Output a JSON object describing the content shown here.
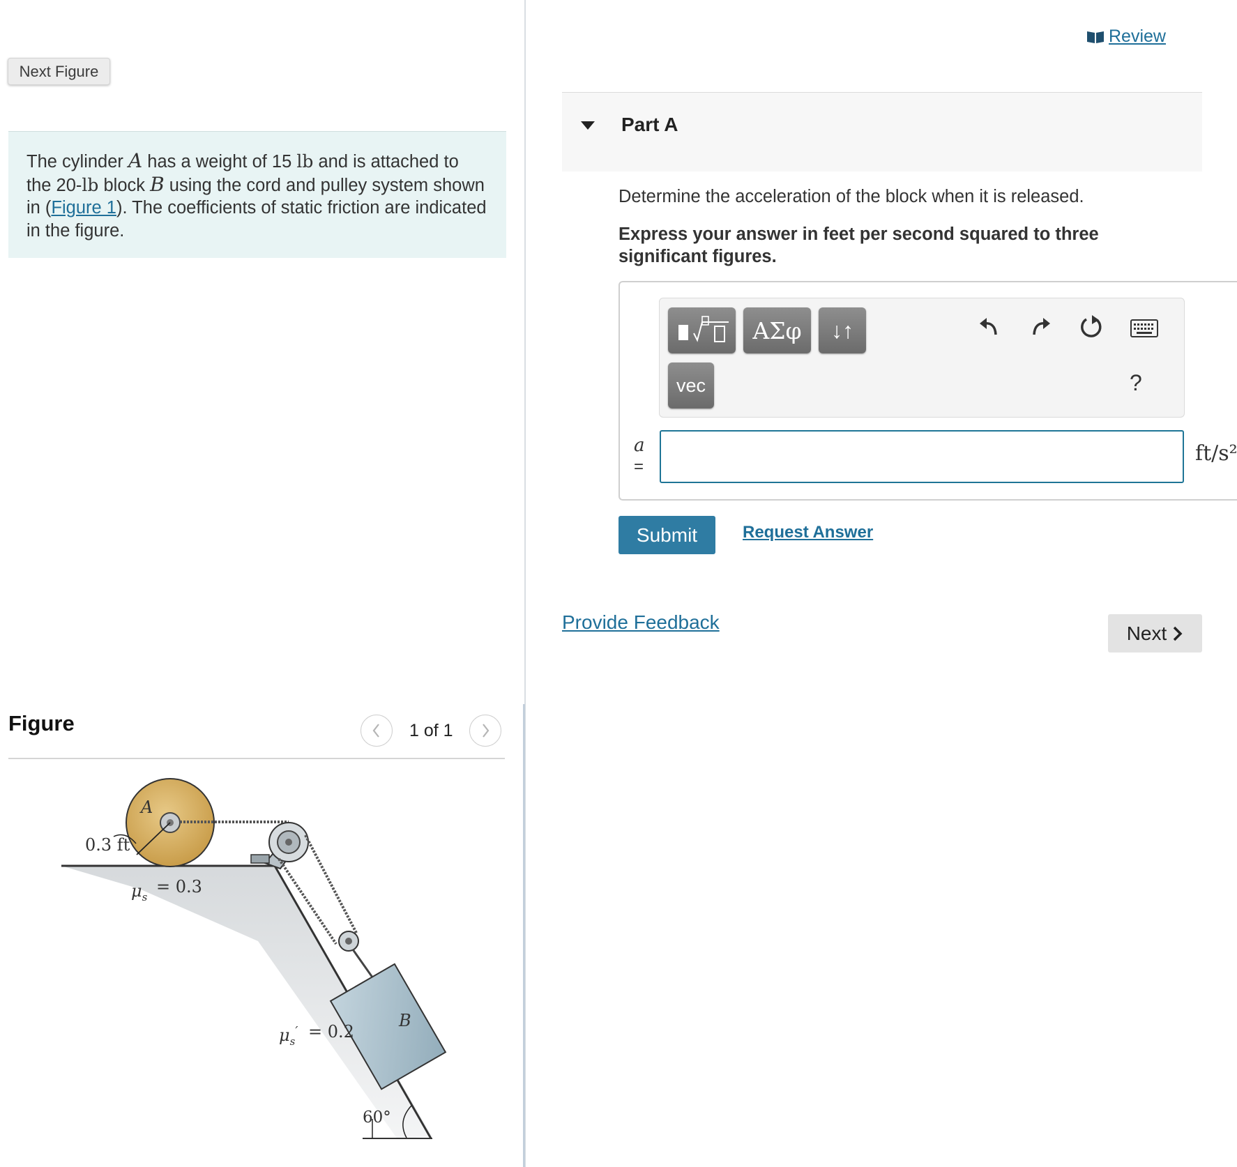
{
  "left_panel": {
    "next_figure_label": "Next Figure",
    "intro": {
      "t1": "The cylinder ",
      "var_a": "A",
      "t2": " has a weight of 15 ",
      "unit1": "lb",
      "t3": " and is attached to the 20-",
      "unit2": "lb",
      "t4": " block ",
      "var_b": "B",
      "t5": " using the cord and pulley system shown in (",
      "link": "Figure 1",
      "t6": "). The coefficients of static friction are indicated in the figure."
    },
    "figure": {
      "title": "Figure",
      "pager": "1 of 1",
      "labels": {
        "cylinder": "A",
        "radius": "0.3 ft",
        "mu_s": "= 0.3",
        "mu_s_prime": "= 0.2",
        "block": "B",
        "angle": "60°"
      }
    }
  },
  "right_panel": {
    "review_label": "Review",
    "part_title": "Part A",
    "question": "Determine the acceleration of the block when it is released.",
    "instructions": "Express your answer in feet per second squared to three significant figures.",
    "toolbar": {
      "greek_label": "ΑΣφ",
      "arrows_label": "↓↑",
      "vec_label": "vec",
      "help_label": "?"
    },
    "answer": {
      "variable": "a",
      "equals": "=",
      "value": "",
      "units": "ft/s²"
    },
    "submit_label": "Submit",
    "request_answer_label": "Request Answer",
    "feedback_label": "Provide Feedback",
    "next_label": "Next"
  },
  "icons": {
    "review": "book-icon",
    "part_toggle": "caret-down-icon",
    "pager_prev": "chevron-left-icon",
    "pager_next": "chevron-right-icon",
    "undo": "undo-icon",
    "redo": "redo-icon",
    "reset": "reset-icon",
    "keyboard": "keyboard-icon",
    "next": "chevron-right-icon"
  },
  "colors": {
    "link": "#1f6f99",
    "submit": "#2f7ca3",
    "intro_bg": "#e8f4f4",
    "input_border": "#1e7596",
    "cylinder": "#d9b46a",
    "block": "#a9c0cd"
  }
}
